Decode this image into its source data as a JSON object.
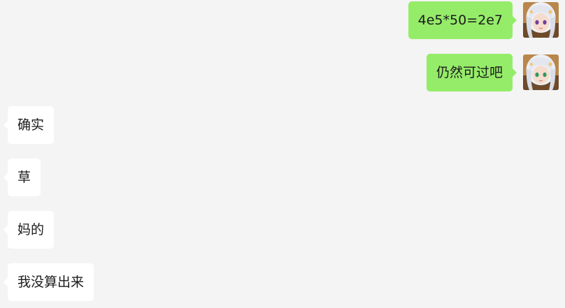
{
  "chat": {
    "messages": [
      {
        "from": "me",
        "text": "4e5*50=2e7",
        "avatar": "anime-girl-avatar"
      },
      {
        "from": "me",
        "text": "仍然可过吧",
        "avatar": "anime-girl-avatar"
      },
      {
        "from": "other",
        "text": "确实"
      },
      {
        "from": "other",
        "text": "草"
      },
      {
        "from": "other",
        "text": "妈的"
      },
      {
        "from": "other",
        "text": "我没算出来"
      }
    ]
  },
  "colors": {
    "background": "#f4f4f4",
    "my_bubble": "#95ec69",
    "other_bubble": "#ffffff",
    "text": "#1b1b1b"
  }
}
